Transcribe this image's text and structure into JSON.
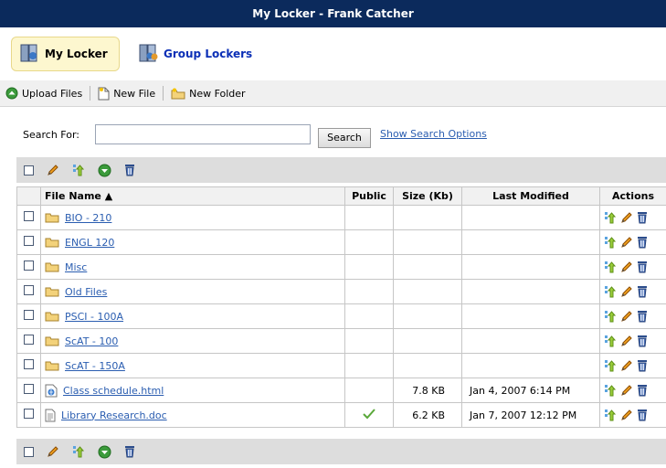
{
  "window": {
    "title": "My Locker - Frank Catcher"
  },
  "tabs": [
    {
      "label": "My Locker",
      "active": true
    },
    {
      "label": "Group Lockers",
      "active": false
    }
  ],
  "toolbar": {
    "upload_label": "Upload Files",
    "new_file_label": "New File",
    "new_folder_label": "New Folder"
  },
  "search": {
    "label": "Search For:",
    "value": "",
    "button_label": "Search",
    "options_link": "Show Search Options"
  },
  "table": {
    "headers": {
      "name": "File Name ▲",
      "public": "Public",
      "size": "Size (Kb)",
      "modified": "Last Modified",
      "actions": "Actions"
    },
    "rows": [
      {
        "type": "folder",
        "name": "BIO - 210",
        "public": false,
        "size": "",
        "modified": ""
      },
      {
        "type": "folder",
        "name": "ENGL 120",
        "public": false,
        "size": "",
        "modified": ""
      },
      {
        "type": "folder",
        "name": "Misc",
        "public": false,
        "size": "",
        "modified": ""
      },
      {
        "type": "folder",
        "name": "Old Files",
        "public": false,
        "size": "",
        "modified": ""
      },
      {
        "type": "folder",
        "name": "PSCI - 100A",
        "public": false,
        "size": "",
        "modified": ""
      },
      {
        "type": "folder",
        "name": "ScAT - 100",
        "public": false,
        "size": "",
        "modified": ""
      },
      {
        "type": "folder",
        "name": "ScAT - 150A",
        "public": false,
        "size": "",
        "modified": ""
      },
      {
        "type": "html",
        "name": "Class schedule.html",
        "public": false,
        "size": "7.8 KB",
        "modified": "Jan 4, 2007 6:14 PM"
      },
      {
        "type": "doc",
        "name": "Library Research.doc",
        "public": true,
        "size": "6.2 KB",
        "modified": "Jan 7, 2007 12:12 PM"
      }
    ]
  },
  "colors": {
    "title_bar": "#0b2a5c",
    "link": "#2a5db0",
    "tab_active_bg": "#fdf7cf",
    "toolbar_bg": "#dddddd",
    "check_green": "#4caf50"
  },
  "icons": {
    "list_tools": [
      "select-all-checkbox",
      "rename-pencil-icon",
      "move-icon",
      "download-icon",
      "trash-icon"
    ],
    "row_actions": [
      "move-icon",
      "rename-pencil-icon",
      "trash-icon"
    ]
  }
}
